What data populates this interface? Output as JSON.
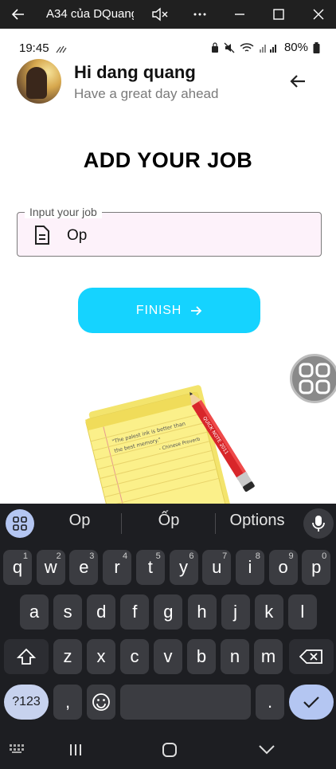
{
  "window": {
    "title": "A34 của DQuang",
    "back_icon": "arrow-left-icon",
    "mute_icon": "speaker-mute-icon",
    "more_icon": "more-dots-icon",
    "minimize_icon": "minimize-icon",
    "maximize_icon": "maximize-icon",
    "close_icon": "close-icon"
  },
  "statusbar": {
    "time": "19:45",
    "battery": "80%"
  },
  "header": {
    "greeting": "Hi dang quang",
    "subtitle": "Have a great day ahead"
  },
  "page": {
    "title": "ADD YOUR JOB"
  },
  "job_input": {
    "label": "Input your job",
    "value": "Op",
    "icon": "document-icon"
  },
  "finish_button": {
    "label": "FINISH"
  },
  "illustration": {
    "quote": "\"The palest ink is better than the best memory.\"",
    "attribution": "- Chinese Proverb",
    "pencil_text": "QUICK NOTE 2011"
  },
  "keyboard": {
    "suggestions": [
      "Op",
      "Ốp",
      "Options"
    ],
    "row1": [
      {
        "k": "q",
        "s": "1"
      },
      {
        "k": "w",
        "s": "2"
      },
      {
        "k": "e",
        "s": "3"
      },
      {
        "k": "r",
        "s": "4"
      },
      {
        "k": "t",
        "s": "5"
      },
      {
        "k": "y",
        "s": "6"
      },
      {
        "k": "u",
        "s": "7"
      },
      {
        "k": "i",
        "s": "8"
      },
      {
        "k": "o",
        "s": "9"
      },
      {
        "k": "p",
        "s": "0"
      }
    ],
    "row2": [
      "a",
      "s",
      "d",
      "f",
      "g",
      "h",
      "j",
      "k",
      "l"
    ],
    "row3": [
      "z",
      "x",
      "c",
      "v",
      "b",
      "n",
      "m"
    ],
    "symbols_label": "?123",
    "comma": ",",
    "period": "."
  },
  "colors": {
    "accent": "#15d3ff",
    "input_bg": "#fdf2fa",
    "keyboard_bg": "#1d1e22",
    "key_bg": "#3b3c41",
    "action_key": "#b4c6f2"
  }
}
